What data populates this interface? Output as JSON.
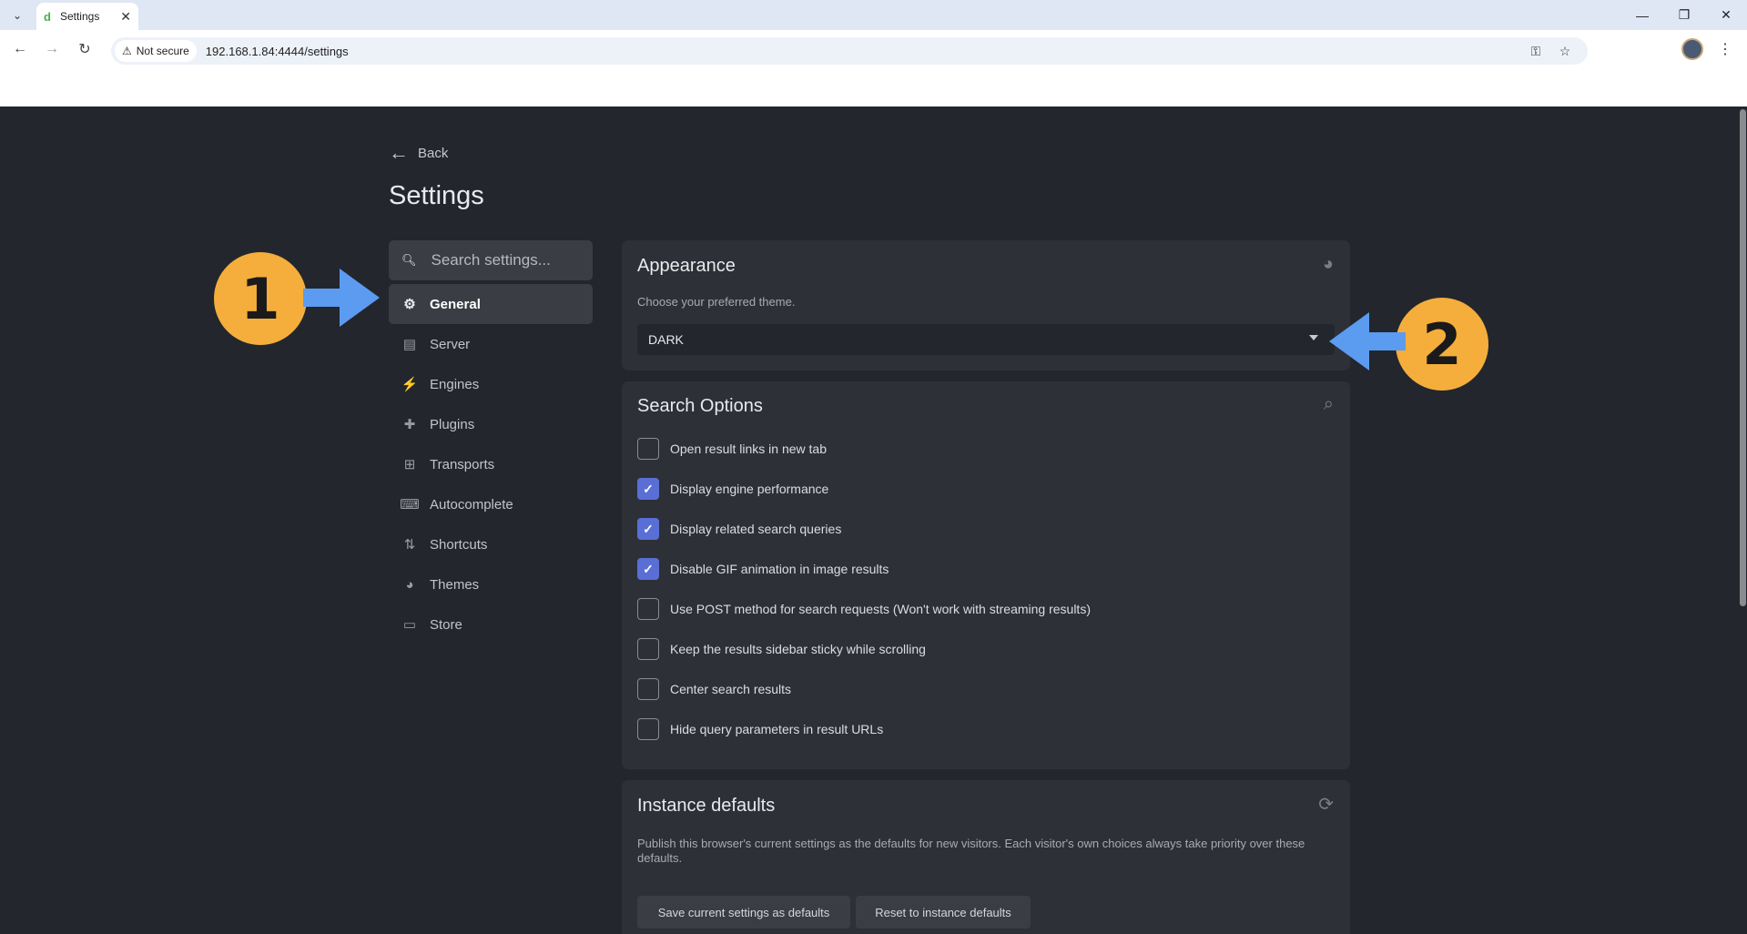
{
  "browser": {
    "tab_title": "Settings",
    "tab_favicon": "d",
    "security_label": "Not secure",
    "url": "192.168.1.84:4444/settings"
  },
  "page": {
    "back_label": "Back",
    "title": "Settings"
  },
  "sidebar": {
    "search_placeholder": "Search settings...",
    "items": [
      {
        "label": "General",
        "icon": "gear-icon",
        "glyph": "⚙"
      },
      {
        "label": "Server",
        "icon": "server-icon",
        "glyph": "▤"
      },
      {
        "label": "Engines",
        "icon": "bolt-icon",
        "glyph": "⚡"
      },
      {
        "label": "Plugins",
        "icon": "puzzle-icon",
        "glyph": "✚"
      },
      {
        "label": "Transports",
        "icon": "network-icon",
        "glyph": "⊞"
      },
      {
        "label": "Autocomplete",
        "icon": "keyboard-icon",
        "glyph": "⌨"
      },
      {
        "label": "Shortcuts",
        "icon": "sort-icon",
        "glyph": "⇅"
      },
      {
        "label": "Themes",
        "icon": "palette-icon",
        "glyph": "◕"
      },
      {
        "label": "Store",
        "icon": "store-icon",
        "glyph": "▭"
      }
    ],
    "active_index": 0
  },
  "appearance": {
    "title": "Appearance",
    "description": "Choose your preferred theme.",
    "theme_value": "DARK"
  },
  "search_options": {
    "title": "Search Options",
    "options": [
      {
        "label": "Open result links in new tab",
        "checked": false
      },
      {
        "label": "Display engine performance",
        "checked": true
      },
      {
        "label": "Display related search queries",
        "checked": true
      },
      {
        "label": "Disable GIF animation in image results",
        "checked": true
      },
      {
        "label": "Use POST method for search requests (Won't work with streaming results)",
        "checked": false
      },
      {
        "label": "Keep the results sidebar sticky while scrolling",
        "checked": false
      },
      {
        "label": "Center search results",
        "checked": false
      },
      {
        "label": "Hide query parameters in result URLs",
        "checked": false
      }
    ]
  },
  "instance_defaults": {
    "title": "Instance defaults",
    "description": "Publish this browser's current settings as the defaults for new visitors. Each visitor's own choices always take priority over these defaults.",
    "save_label": "Save current settings as defaults",
    "reset_label": "Reset to instance defaults"
  },
  "annotations": {
    "badge1": "1",
    "badge2": "2",
    "color": "#f5ae3b",
    "arrow_color": "#5b9bf0"
  },
  "colors": {
    "background": "#23262d",
    "card": "#2e3037",
    "accent_checkbox": "#5a6fd6"
  }
}
